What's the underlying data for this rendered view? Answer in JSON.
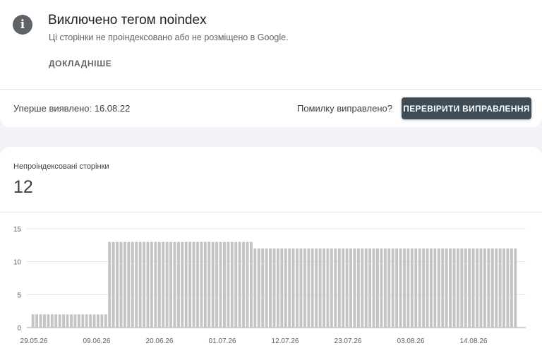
{
  "issue": {
    "title": "Виключено тегом noindex",
    "description": "Ці сторінки не проіндексовано або не розміщено в Google.",
    "details_label": "ДОКЛАДНІШЕ",
    "first_detected": "Уперше виявлено: 16.08.22",
    "fixed_question": "Помилку виправлено?",
    "validate_label": "ПЕРЕВІРИТИ ВИПРАВЛЕННЯ"
  },
  "metric": {
    "label": "Непроіндексовані сторінки",
    "value": "12"
  },
  "colors": {
    "bar": "#c4c4c4",
    "button": "#3d4c57",
    "icon": "#5f6368"
  },
  "chart_data": {
    "type": "bar",
    "ylim": [
      0,
      15
    ],
    "y_ticks": [
      0,
      5,
      10,
      15
    ],
    "x_tick_labels": [
      "29.05.26",
      "09.06.26",
      "20.06.26",
      "01.07.26",
      "12.07.26",
      "23.07.26",
      "03.08.26",
      "14.08.26"
    ],
    "grid": true,
    "series": [
      {
        "values": [
          2,
          2,
          2,
          2,
          2,
          2,
          2,
          2,
          2,
          2,
          2,
          2,
          2,
          2,
          2,
          2,
          2,
          2,
          2,
          2,
          13,
          13,
          13,
          13,
          13,
          13,
          13,
          13,
          13,
          13,
          13,
          13,
          13,
          13,
          13,
          13,
          13,
          13,
          13,
          13,
          13,
          13,
          13,
          13,
          13,
          13,
          13,
          13,
          13,
          13,
          13,
          13,
          13,
          13,
          13,
          13,
          13,
          13,
          12,
          12,
          12,
          12,
          12,
          12,
          12,
          12,
          12,
          12,
          12,
          12,
          12,
          12,
          12,
          12,
          12,
          12,
          12,
          12,
          12,
          12,
          12,
          12,
          12,
          12,
          12,
          12,
          12,
          12,
          12,
          12,
          12,
          12,
          12,
          12,
          12,
          12,
          12,
          12,
          12,
          12,
          12,
          12,
          12,
          12,
          12,
          12,
          12,
          12,
          12,
          12,
          12,
          12,
          12,
          12,
          12,
          12,
          12,
          12,
          12,
          12,
          12,
          12,
          12,
          12,
          12,
          12,
          12
        ]
      }
    ]
  }
}
